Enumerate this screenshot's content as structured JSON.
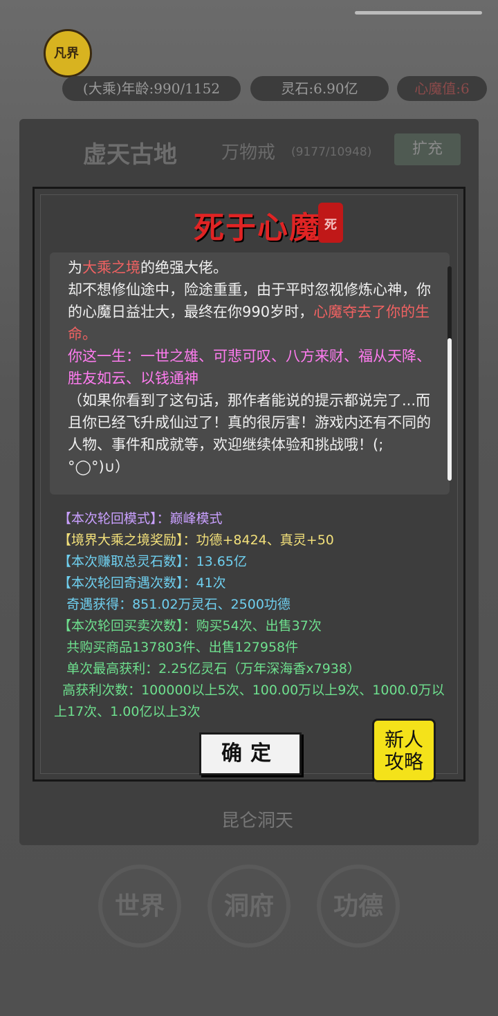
{
  "status": {
    "gourd_label": "凡界",
    "realm_age": "(大乘)年龄:990/1152",
    "spirit_stone": "灵石:6.90亿",
    "heart_demon": "心魔值:6"
  },
  "background": {
    "area_title": "虚天古地",
    "ring_label": "万物戒",
    "ring_count": "(9177/10948)",
    "expand_button": "扩充",
    "city_name": "昆仑洞天",
    "nav": [
      "世界",
      "洞府",
      "功德"
    ]
  },
  "modal": {
    "title": "死于心魔",
    "seal_text": "死",
    "story": {
      "p1_a": "为",
      "p1_realm": "大乘之境",
      "p1_b": "的绝强大佬。",
      "p2_a": "却不想修仙途中，险途重重，由于平时忽视修炼心神，你的心魔日益壮大，最终在你990岁时，",
      "p2_red": "心魔夺去了你的生命。",
      "p3_pink": "你这一生：一世之雄、可悲可叹、八方来财、福从天降、胜友如云、以钱通神",
      "p4": "（如果你看到了这句话，那作者能说的提示都说完了...而且你已经飞升成仙过了！真的很厉害！游戏内还有不同的人物、事件和成就等，欢迎继续体验和挑战哦！(; °◯°)∪）"
    },
    "results": [
      {
        "text": "【本次轮回模式】：巅峰模式",
        "color": "purple"
      },
      {
        "text": "【境界大乘之境奖励】：功德+8424、真灵+50",
        "color": "yellow"
      },
      {
        "text": "【本次赚取总灵石数】：13.65亿",
        "color": "cyan"
      },
      {
        "text": "【本次轮回奇遇次数】：41次",
        "color": "cyan"
      },
      {
        "text": "  奇遇获得：851.02万灵石、2500功德",
        "color": "cyan"
      },
      {
        "text": "【本次轮回买卖次数】：购买54次、出售37次",
        "color": "green"
      },
      {
        "text": "  共购买商品137803件、出售127958件",
        "color": "green"
      },
      {
        "text": "  单次最高获利：2.25亿灵石（万年深海香x7938）",
        "color": "green"
      },
      {
        "text": "  高获利次数：100000以上5次、100.00万以上9次、1000.0万以上17次、1.00亿以上3次",
        "color": "green"
      }
    ],
    "confirm_button": "确定",
    "guide_button_line1": "新人",
    "guide_button_line2": "攻略"
  },
  "colors": {
    "title_red": "#e02424",
    "realm_red": "#f06262",
    "epitaph_pink": "#ff7cf0",
    "mode_purple": "#c9a0ff",
    "reward_yellow": "#f2e07a",
    "stone_cyan": "#6fd0f0",
    "trade_green": "#6ee08e",
    "guide_yellow": "#f4e21a"
  }
}
